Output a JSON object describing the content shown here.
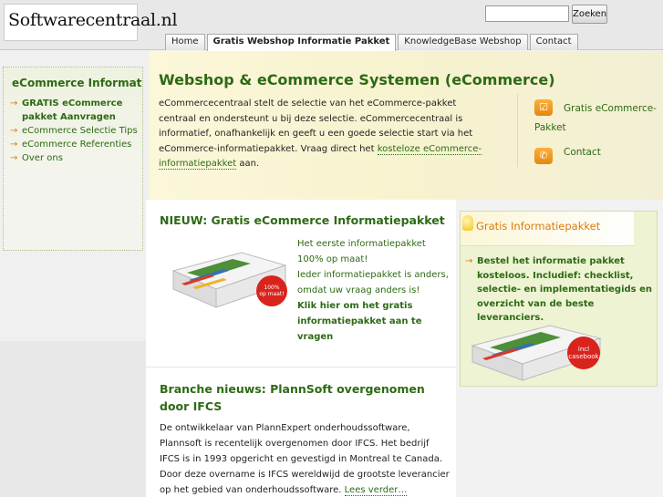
{
  "header": {
    "logo_text": "Softwarecentraal.nl",
    "search": {
      "value": "",
      "placeholder": "",
      "button_label": "Zoeken"
    }
  },
  "nav": {
    "tabs": [
      {
        "label": "Home",
        "active": false
      },
      {
        "label": "Gratis Webshop Informatie Pakket",
        "active": true
      },
      {
        "label": "KnowledgeBase Webshop",
        "active": false
      },
      {
        "label": "Contact",
        "active": false
      }
    ]
  },
  "sidebar": {
    "title": "eCommerce Informatie",
    "items": [
      {
        "label": "GRATIS eCommerce pakket Aanvragen",
        "bold": true
      },
      {
        "label": "eCommerce Selectie Tips",
        "bold": false
      },
      {
        "label": "eCommerce Referenties",
        "bold": false
      },
      {
        "label": "Over ons",
        "bold": false
      }
    ],
    "arrow_glyph": "→"
  },
  "intro": {
    "title": "Webshop & eCommerce Systemen (eCommerce)",
    "text_before": "eCommercecentraal stelt de selectie van het eCommerce-pakket centraal en ondersteunt u bij deze selectie. eCommercecentraal is informatief, onafhankelijk en geeft u een goede selectie start via het eCommerce-informatiepakket. Vraag direct het ",
    "link_text": "kosteloze eCommerce-informatiepakket",
    "text_after": " aan."
  },
  "quicklinks": [
    {
      "label": "Gratis eCommerce-Pakket",
      "icon": "checkbox-icon"
    },
    {
      "label": "Contact",
      "icon": "phone-icon"
    }
  ],
  "news": [
    {
      "title": "NIEUW: Gratis eCommerce Informatiepakket",
      "lines": [
        "Het eerste informatiepakket 100% op maat!",
        "Ieder informatiepakket is anders, omdat uw vraag anders is!"
      ],
      "cta": "Klik hier om het gratis informatiepakket aan te vragen",
      "badge": "100% op maat!"
    },
    {
      "title": "Branche nieuws: PlannSoft overgenomen door IFCS",
      "body": "De ontwikkelaar van PlannExpert onderhoudssoftware, Plannsoft is recentelijk overgenomen door IFCS. Het bedrijf IFCS is in 1993 opgericht en gevestigd in Montreal te Canada. Door deze overname is IFCS wereldwijd de grootste leverancier op het gebied van onderhoudssoftware.",
      "read_more": "Lees verder…"
    }
  ],
  "promo": {
    "title": "Gratis Informatiepakket",
    "text": "Bestel het informatie pakket kosteloos. Includief: checklist, selectie- en implementatiegids en overzicht van de beste leveranciers.",
    "badge": "incl casebook"
  },
  "colors": {
    "brand_green": "#2d6a14",
    "accent_orange": "#d97b12",
    "badge_red": "#d8241c"
  }
}
